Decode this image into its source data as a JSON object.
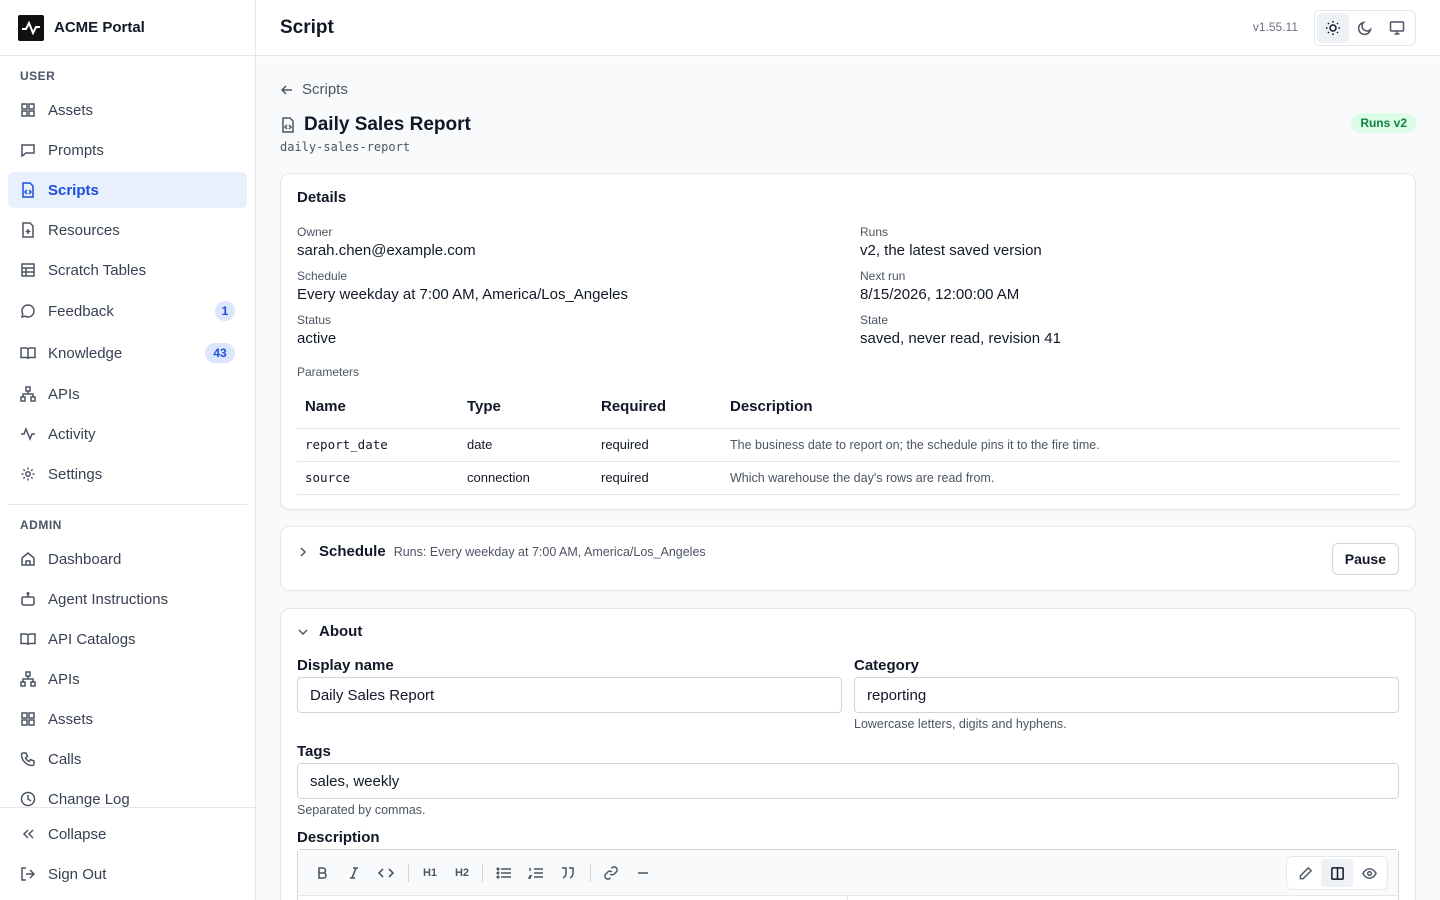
{
  "app": {
    "name": "ACME Portal",
    "version": "v1.55.11"
  },
  "topbar": {
    "title": "Script"
  },
  "sidebar": {
    "user_label": "USER",
    "user_items": [
      {
        "label": "Assets",
        "icon": "grid-icon"
      },
      {
        "label": "Prompts",
        "icon": "message-square-icon"
      },
      {
        "label": "Scripts",
        "icon": "file-code-icon",
        "active": true
      },
      {
        "label": "Resources",
        "icon": "file-plus-icon"
      },
      {
        "label": "Scratch Tables",
        "icon": "table-icon"
      },
      {
        "label": "Feedback",
        "icon": "message-circle-icon",
        "badge": "1"
      },
      {
        "label": "Knowledge",
        "icon": "book-open-icon",
        "badge": "43"
      },
      {
        "label": "APIs",
        "icon": "network-icon"
      },
      {
        "label": "Activity",
        "icon": "activity-icon"
      },
      {
        "label": "Settings",
        "icon": "gear-icon"
      }
    ],
    "admin_label": "ADMIN",
    "admin_items": [
      {
        "label": "Dashboard",
        "icon": "home-icon"
      },
      {
        "label": "Agent Instructions",
        "icon": "bot-icon"
      },
      {
        "label": "API Catalogs",
        "icon": "book-open-icon"
      },
      {
        "label": "APIs",
        "icon": "network-icon"
      },
      {
        "label": "Assets",
        "icon": "grid-icon"
      },
      {
        "label": "Calls",
        "icon": "phone-icon"
      },
      {
        "label": "Change Log",
        "icon": "clock-icon"
      }
    ],
    "collapse_label": "Collapse",
    "signout_label": "Sign Out"
  },
  "page": {
    "back_label": "Scripts",
    "title": "Daily Sales Report",
    "slug": "daily-sales-report",
    "runs_badge": "Runs v2"
  },
  "details": {
    "title": "Details",
    "owner_label": "Owner",
    "owner": "sarah.chen@example.com",
    "runs_label": "Runs",
    "runs": "v2, the latest saved version",
    "schedule_label": "Schedule",
    "schedule": "Every weekday at 7:00 AM, America/Los_Angeles",
    "next_run_label": "Next run",
    "next_run": "8/15/2026, 12:00:00 AM",
    "status_label": "Status",
    "status": "active",
    "state_label": "State",
    "state": "saved, never read, revision 41",
    "parameters_label": "Parameters",
    "columns": [
      "Name",
      "Type",
      "Required",
      "Description"
    ],
    "rows": [
      [
        "report_date",
        "date",
        "required",
        "The business date to report on; the schedule pins it to the fire time."
      ],
      [
        "source",
        "connection",
        "required",
        "Which warehouse the day's rows are read from."
      ]
    ]
  },
  "schedule_card": {
    "title": "Schedule",
    "summary": "Runs: Every weekday at 7:00 AM, America/Los_Angeles",
    "pause_label": "Pause"
  },
  "about": {
    "title": "About",
    "display_name_label": "Display name",
    "display_name": "Daily Sales Report",
    "category_label": "Category",
    "category": "reporting",
    "category_hint": "Lowercase letters, digits and hyphens.",
    "tags_label": "Tags",
    "tags": "sales, weekly",
    "tags_hint": "Separated by commas.",
    "description_label": "Description",
    "toolbar": {
      "h1": "H1",
      "h2": "H2"
    }
  },
  "colors": {
    "accent": "#1d4ed8",
    "accent_bg": "#e8effd",
    "success_bg": "#dcfce7",
    "success_text": "#15803d"
  }
}
